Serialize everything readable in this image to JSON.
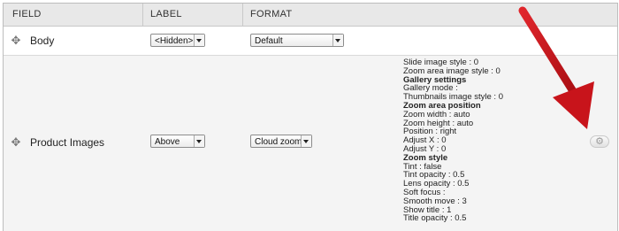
{
  "table": {
    "headers": [
      "FIELD",
      "LABEL",
      "FORMAT"
    ],
    "rows": [
      {
        "field": "Body",
        "label": "<Hidden>",
        "format": "Default",
        "drag_icon": "move-handle-icon"
      },
      {
        "field": "Product Images",
        "label": "Above",
        "format": "Cloud zoom",
        "drag_icon": "move-handle-icon",
        "settings_icon": "gear-icon",
        "summary": [
          "Slide image style : 0",
          "Zoom area image style : 0",
          "Gallery settings",
          "Gallery mode :",
          "Thumbnails image style : 0",
          "Zoom area position",
          "Zoom width : auto",
          "Zoom height : auto",
          "Position : right",
          "Adjust X : 0",
          "Adjust Y : 0",
          "Zoom style",
          "Tint : false",
          "Tint opacity : 0.5",
          "Lens opacity : 0.5",
          "Soft focus :",
          "Smooth move : 3",
          "Show title : 1",
          "Title opacity : 0.5"
        ],
        "summary_headings": [
          "Gallery settings",
          "Zoom area position",
          "Zoom style"
        ]
      }
    ]
  },
  "colors": {
    "header_bg": "#e8e8e8",
    "row_alt_bg": "#f4f4f4",
    "annotation_arrow": "#c8141b"
  }
}
